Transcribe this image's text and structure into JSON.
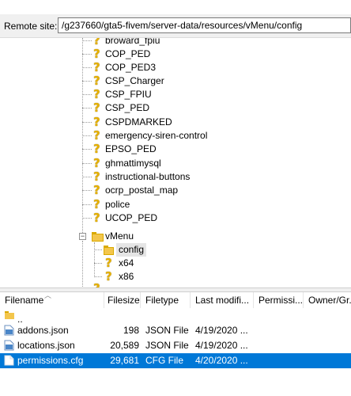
{
  "remote_site": {
    "label": "Remote site:",
    "path": "/g237660/gta5-fivem/server-data/resources/vMenu/config"
  },
  "tree": {
    "items": [
      {
        "label": "broward_fpiu",
        "icon": "unknown-question-icon"
      },
      {
        "label": "COP_PED",
        "icon": "unknown-question-icon"
      },
      {
        "label": "COP_PED3",
        "icon": "unknown-question-icon"
      },
      {
        "label": "CSP_Charger",
        "icon": "unknown-question-icon"
      },
      {
        "label": "CSP_FPIU",
        "icon": "unknown-question-icon"
      },
      {
        "label": "CSP_PED",
        "icon": "unknown-question-icon"
      },
      {
        "label": "CSPDMARKED",
        "icon": "unknown-question-icon"
      },
      {
        "label": "emergency-siren-control",
        "icon": "unknown-question-icon"
      },
      {
        "label": "EPSO_PED",
        "icon": "unknown-question-icon"
      },
      {
        "label": "ghmattimysql",
        "icon": "unknown-question-icon"
      },
      {
        "label": "instructional-buttons",
        "icon": "unknown-question-icon"
      },
      {
        "label": "ocrp_postal_map",
        "icon": "unknown-question-icon"
      },
      {
        "label": "police",
        "icon": "unknown-question-icon"
      },
      {
        "label": "UCOP_PED",
        "icon": "unknown-question-icon"
      },
      {
        "label": "vMenu",
        "icon": "folder-open-icon",
        "expanded": true
      }
    ],
    "children": [
      {
        "label": "config",
        "icon": "folder-icon",
        "selected": true
      },
      {
        "label": "x64",
        "icon": "unknown-question-icon"
      },
      {
        "label": "x86",
        "icon": "unknown-question-icon"
      }
    ]
  },
  "file_list": {
    "columns": [
      "Filename",
      "Filesize",
      "Filetype",
      "Last modifi...",
      "Permissi...",
      "Owner/Gr..."
    ],
    "rows": [
      {
        "name": "..",
        "size": "",
        "type": "",
        "modified": "",
        "icon": "parent-folder-icon",
        "selected": false
      },
      {
        "name": "addons.json",
        "size": "198",
        "type": "JSON File",
        "modified": "4/19/2020 ...",
        "icon": "json-file-icon",
        "selected": false
      },
      {
        "name": "locations.json",
        "size": "20,589",
        "type": "JSON File",
        "modified": "4/19/2020 ...",
        "icon": "json-file-icon",
        "selected": false
      },
      {
        "name": "permissions.cfg",
        "size": "29,681",
        "type": "CFG File",
        "modified": "4/20/2020 ...",
        "icon": "cfg-file-icon",
        "selected": true
      }
    ]
  },
  "colors": {
    "selection": "#0078d7",
    "question_icon": "#e5b000",
    "folder": "#f3c64c"
  }
}
